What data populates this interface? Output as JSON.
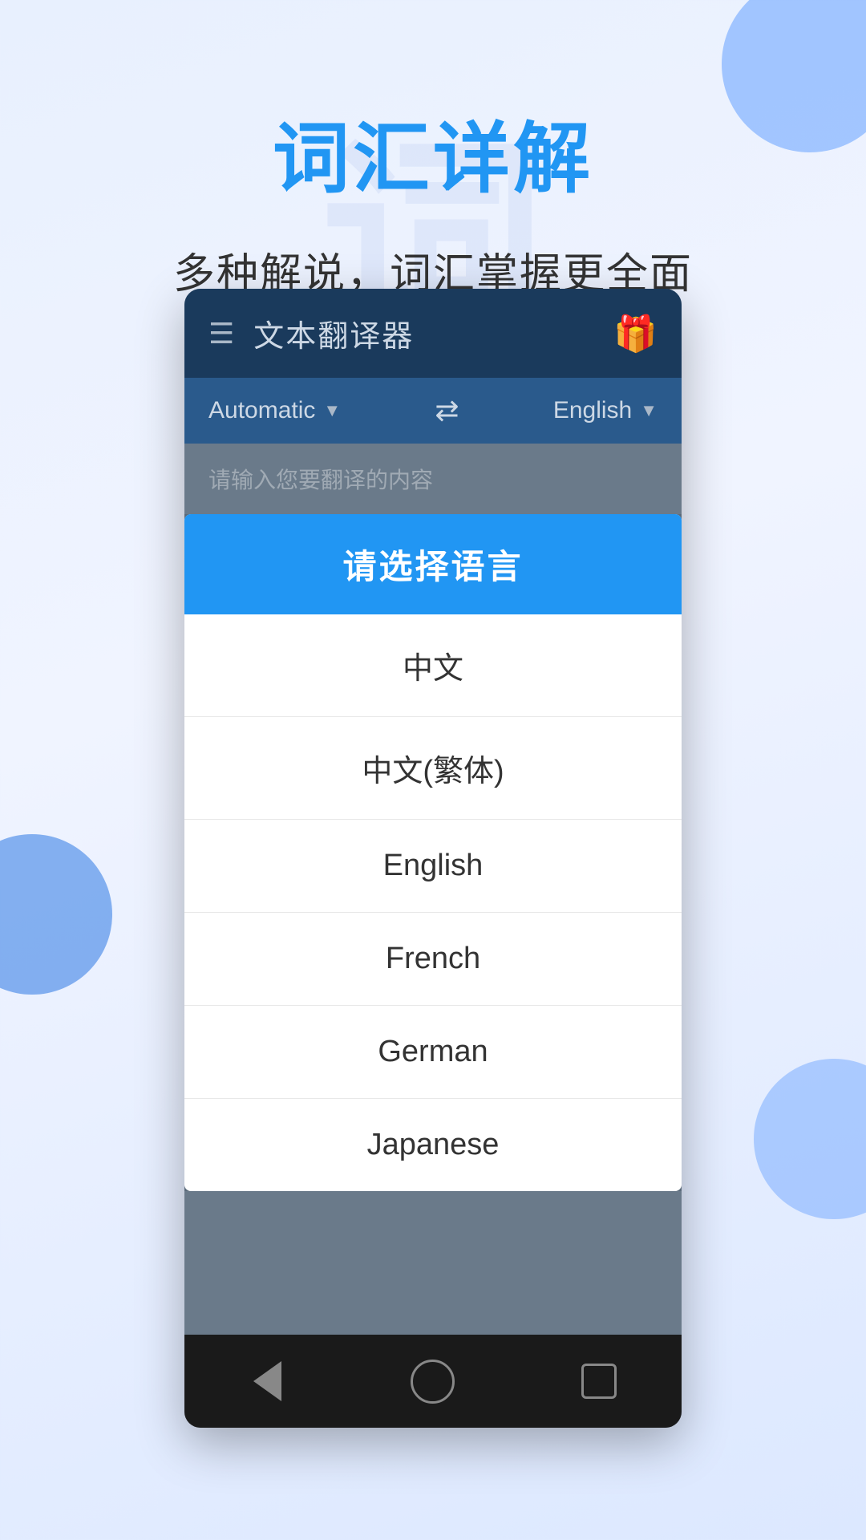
{
  "background": {
    "watermark": "词"
  },
  "hero": {
    "title": "词汇详解",
    "subtitle": "多种解说，词汇掌握更全面"
  },
  "app": {
    "nav": {
      "title": "文本翻译器",
      "hamburger": "☰",
      "gift_emoji": "🎁"
    },
    "lang_bar": {
      "source_lang": "Automatic",
      "target_lang": "English",
      "swap": "⇄"
    },
    "translator": {
      "placeholder": "请输入您要翻译的内容"
    },
    "dialog": {
      "header": "请选择语言",
      "items": [
        {
          "label": "中文"
        },
        {
          "label": "中文(繁体)"
        },
        {
          "label": "English"
        },
        {
          "label": "French"
        },
        {
          "label": "German"
        },
        {
          "label": "Japanese"
        }
      ]
    }
  }
}
